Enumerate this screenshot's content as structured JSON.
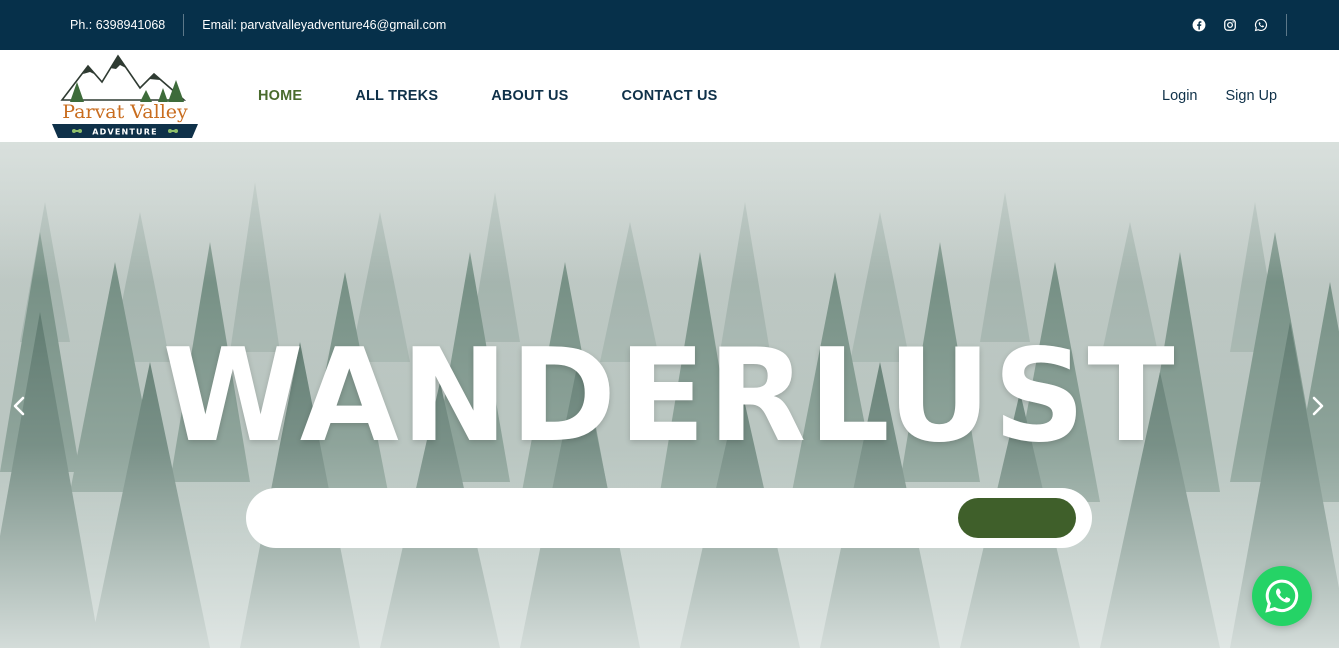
{
  "topbar": {
    "phone": "Ph.: 6398941068",
    "email": "Email: parvatvalleyadventure46@gmail.com",
    "socials": [
      "facebook-icon",
      "instagram-icon",
      "whatsapp-icon"
    ]
  },
  "logo": {
    "name": "Parvat Valley",
    "tagline": "ADVENTURE"
  },
  "nav": {
    "items": [
      {
        "label": "HOME",
        "active": true
      },
      {
        "label": "ALL TREKS",
        "active": false
      },
      {
        "label": "ABOUT US",
        "active": false
      },
      {
        "label": "CONTACT US",
        "active": false
      }
    ],
    "login": "Login",
    "signup": "Sign Up"
  },
  "hero": {
    "title": "WANDERLUST"
  },
  "colors": {
    "topbar": "#06304a",
    "nav_text": "#0f3149",
    "active": "#4a6b2d",
    "accent_green": "#3f5f2a",
    "whatsapp": "#25d366"
  }
}
